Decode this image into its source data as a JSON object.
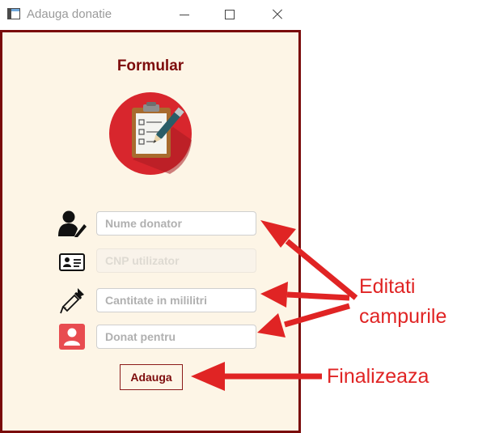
{
  "window": {
    "title": "Adauga donatie",
    "controls": {
      "minimize": "minimize-icon",
      "maximize": "maximize-icon",
      "close": "close-icon"
    }
  },
  "form": {
    "title": "Formular",
    "icon": "clipboard-icon",
    "fields": [
      {
        "name": "nume-donator",
        "icon": "user-edit-icon",
        "placeholder": "Nume donator",
        "value": "",
        "enabled": true
      },
      {
        "name": "cnp-utilizator",
        "icon": "id-card-icon",
        "placeholder": "CNP utilizator",
        "value": "",
        "enabled": false
      },
      {
        "name": "cantitate",
        "icon": "dropper-icon",
        "placeholder": "Cantitate in mililitri",
        "value": "",
        "enabled": true
      },
      {
        "name": "donat-pentru",
        "icon": "person-icon",
        "placeholder": "Donat pentru",
        "value": "",
        "enabled": true
      }
    ],
    "submit_label": "Adauga"
  },
  "annotations": {
    "edit_line1": "Editati",
    "edit_line2": "campurile",
    "finalize": "Finalizeaza",
    "color": "#e02424"
  },
  "colors": {
    "accent": "#7d0c0c",
    "background": "#fdf5e6",
    "icon_circle": "#d8262d"
  }
}
